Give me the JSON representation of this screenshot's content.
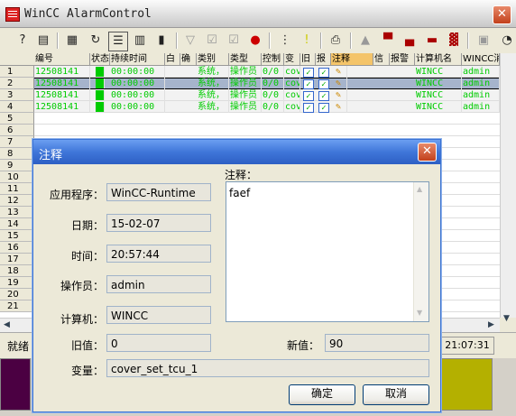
{
  "window": {
    "title": "WinCC AlarmControl",
    "close_symbol": "✕"
  },
  "toolbar": {
    "icons": [
      "help-icon",
      "list-icon",
      "window-icon",
      "refresh-icon",
      "filter-dialog-icon",
      "alarm-list-icon",
      "bar-chart-icon",
      "filter-icon",
      "check-icon",
      "acknowledge-icon",
      "alarm-stop-icon",
      "select-list-icon",
      "info-icon",
      "print-icon",
      "first-icon",
      "prev-page-icon",
      "next-page-icon",
      "last-icon",
      "lock-icon",
      "clock-icon"
    ]
  },
  "grid": {
    "columns": [
      "编号",
      "状态",
      "持续时间",
      "白",
      "确",
      "类别",
      "类型",
      "控制",
      "变",
      "旧",
      "报",
      "注释",
      "信",
      "报警",
      "计算机名",
      "WINCC消息"
    ],
    "row_numbers": [
      "1",
      "2",
      "3",
      "4",
      "5",
      "6",
      "7",
      "8",
      "9",
      "10",
      "11",
      "12",
      "13",
      "14",
      "15",
      "16",
      "17",
      "18",
      "19",
      "20",
      "21"
    ],
    "rows": [
      {
        "num": "12508141",
        "dur": "00:00:00",
        "cat": "系统，",
        "type": "操作员",
        "ctl": "0/0",
        "var": "cov",
        "pc": "WINCC",
        "msg": "admin"
      },
      {
        "num": "12508141",
        "dur": "00:00:00",
        "cat": "系统，",
        "type": "操作员",
        "ctl": "0/0",
        "var": "cov",
        "pc": "WINCC",
        "msg": "admin"
      },
      {
        "num": "12508141",
        "dur": "00:00:00",
        "cat": "系统，",
        "type": "操作员",
        "ctl": "0/0",
        "var": "cov",
        "pc": "WINCC",
        "msg": "admin"
      },
      {
        "num": "12508141",
        "dur": "00:00:00",
        "cat": "系统，",
        "type": "操作员",
        "ctl": "0/0",
        "var": "cov",
        "pc": "WINCC",
        "msg": "admin"
      }
    ]
  },
  "status": {
    "ready": "就绪",
    "time": "21:07:31"
  },
  "dialog": {
    "title": "注释",
    "close_symbol": "✕",
    "app_label": "应用程序：",
    "app_value": "WinCC-Runtime",
    "date_label": "日期：",
    "date_value": "15-02-07",
    "time_label": "时间：",
    "time_value": "20:57:44",
    "operator_label": "操作员：",
    "operator_value": "admin",
    "computer_label": "计算机：",
    "computer_value": "WINCC",
    "comment_label": "注释：",
    "comment_value": "faef",
    "old_label": "旧值：",
    "old_value": "0",
    "new_label": "新值：",
    "new_value": "90",
    "tag_label": "变量：",
    "tag_value": "cover_set_tcu_1",
    "ok_label": "确定",
    "cancel_label": "取消"
  },
  "colors": {
    "alarm_text": "#00cc00",
    "selected_row": "#a6b4cc",
    "dialog_title": "#3f76d9",
    "bottom_purple": "#4b0042",
    "bottom_olive": "#b4b000"
  }
}
